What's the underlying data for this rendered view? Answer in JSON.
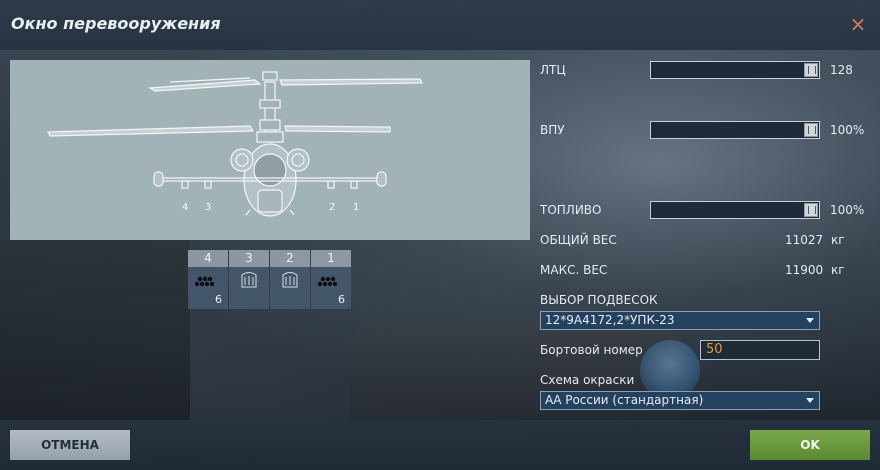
{
  "window": {
    "title": "Окно перевооружения",
    "close_symbol": "×"
  },
  "pylons": [
    {
      "number": "4",
      "count": "6",
      "icon": "rocket-pod-icon"
    },
    {
      "number": "3",
      "count": "",
      "icon": "missile-rack-icon"
    },
    {
      "number": "2",
      "count": "",
      "icon": "missile-rack-icon"
    },
    {
      "number": "1",
      "count": "6",
      "icon": "rocket-pod-icon"
    }
  ],
  "preview": {
    "station_labels": [
      "4",
      "3",
      "2",
      "1"
    ]
  },
  "ltc": {
    "label": "ЛТЦ",
    "value": "128",
    "fraction": 1.0
  },
  "vpu": {
    "label": "ВПУ",
    "value": "100%",
    "fraction": 1.0
  },
  "fuel": {
    "label": "ТОПЛИВО",
    "value": "100%",
    "fraction": 1.0
  },
  "gross_weight": {
    "label": "ОБЩИЙ ВЕС",
    "value": "11027",
    "unit": "кг"
  },
  "max_weight": {
    "label": "МАКС. ВЕС",
    "value": "11900",
    "unit": "кг"
  },
  "loadout": {
    "label": "ВЫБОР ПОДВЕСОК",
    "selected": "12*9А4172,2*УПК-23"
  },
  "tail_number": {
    "label": "Бортовой номер",
    "value": "50"
  },
  "livery": {
    "label": "Схема окраски",
    "selected": "АА России (стандартная)"
  },
  "buttons": {
    "cancel": "ОТМЕНА",
    "ok": "OK"
  },
  "colors": {
    "accent_ok": "#6b9a3e",
    "tail_number_text": "#e49a3c",
    "close": "#d87a60"
  }
}
